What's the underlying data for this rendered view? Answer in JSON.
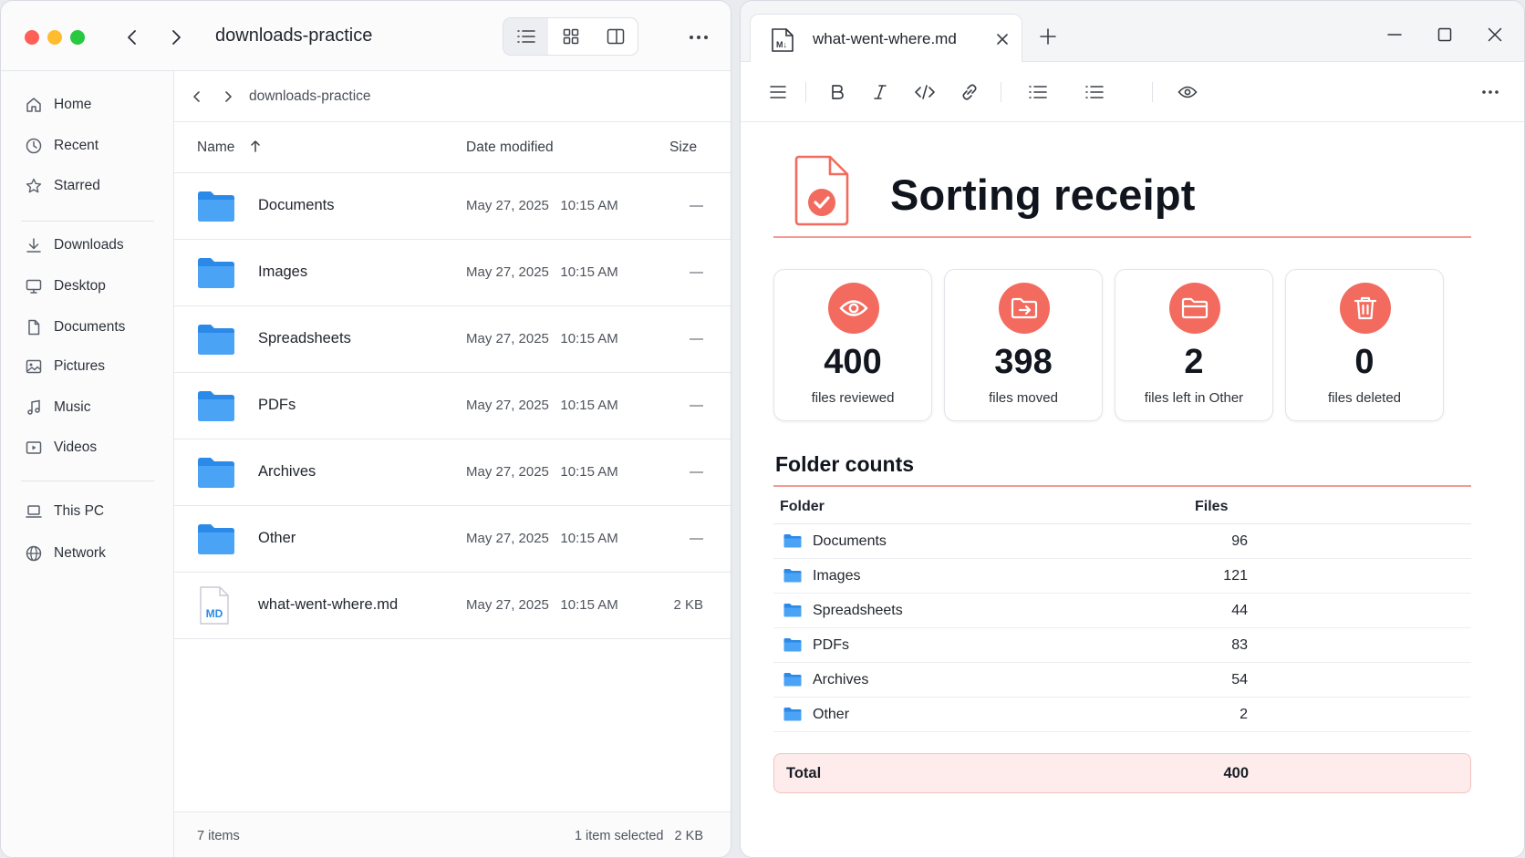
{
  "file_manager": {
    "title": "downloads-practice",
    "sidebar": [
      {
        "label": "Home",
        "icon": "home-icon"
      },
      {
        "label": "Recent",
        "icon": "clock-icon"
      },
      {
        "label": "Starred",
        "icon": "star-icon"
      },
      {
        "label": "Downloads",
        "icon": "download-icon"
      },
      {
        "label": "Desktop",
        "icon": "monitor-icon"
      },
      {
        "label": "Documents",
        "icon": "document-icon"
      },
      {
        "label": "Pictures",
        "icon": "image-icon"
      },
      {
        "label": "Music",
        "icon": "music-icon"
      },
      {
        "label": "Videos",
        "icon": "video-icon"
      },
      {
        "label": "This PC",
        "icon": "laptop-icon"
      },
      {
        "label": "Network",
        "icon": "globe-icon"
      }
    ],
    "breadcrumb": "downloads-practice",
    "columns": {
      "name": "Name",
      "date": "Date modified",
      "size": "Size"
    },
    "rows": [
      {
        "name": "Documents",
        "date": "May 27, 2025   10:15 AM",
        "size": "—",
        "type": "folder"
      },
      {
        "name": "Images",
        "date": "May 27, 2025   10:15 AM",
        "size": "—",
        "type": "folder"
      },
      {
        "name": "Spreadsheets",
        "date": "May 27, 2025   10:15 AM",
        "size": "—",
        "type": "folder"
      },
      {
        "name": "PDFs",
        "date": "May 27, 2025   10:15 AM",
        "size": "—",
        "type": "folder"
      },
      {
        "name": "Archives",
        "date": "May 27, 2025   10:15 AM",
        "size": "—",
        "type": "folder"
      },
      {
        "name": "Other",
        "date": "May 27, 2025   10:15 AM",
        "size": "—",
        "type": "folder"
      },
      {
        "name": "what-went-where.md",
        "date": "May 27, 2025   10:15 AM",
        "size": "2 KB",
        "type": "markdown",
        "badge": "MD"
      }
    ],
    "status": {
      "left": "7 items",
      "right": "1 item selected   2 KB"
    }
  },
  "editor": {
    "tab": {
      "name": "what-went-where.md",
      "badge": "M↓"
    },
    "doc_title": "Sorting receipt",
    "cards": [
      {
        "value": "400",
        "label": "files reviewed",
        "icon": "eye-icon"
      },
      {
        "value": "398",
        "label": "files moved",
        "icon": "folder-move-icon"
      },
      {
        "value": "2",
        "label": "files left in Other",
        "icon": "folder-icon"
      },
      {
        "value": "0",
        "label": "files deleted",
        "icon": "trash-icon"
      }
    ],
    "section_title": "Folder counts",
    "table": {
      "headers": {
        "folder": "Folder",
        "files": "Files"
      },
      "rows": [
        {
          "folder": "Documents",
          "files": "96"
        },
        {
          "folder": "Images",
          "files": "121"
        },
        {
          "folder": "Spreadsheets",
          "files": "44"
        },
        {
          "folder": "PDFs",
          "files": "83"
        },
        {
          "folder": "Archives",
          "files": "54"
        },
        {
          "folder": "Other",
          "files": "2"
        }
      ],
      "total": {
        "label": "Total",
        "value": "400"
      }
    }
  },
  "colors": {
    "accent": "#f26b5e",
    "folder": "#2b8ae8",
    "total_bg": "#fdeceb"
  }
}
